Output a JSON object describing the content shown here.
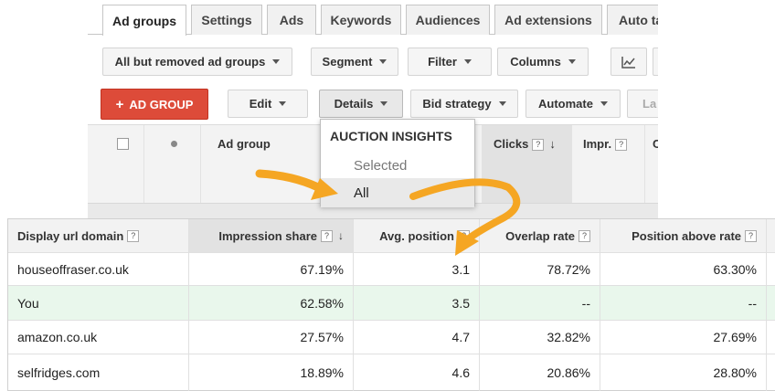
{
  "tabs": [
    {
      "label": "Ad groups",
      "active": true
    },
    {
      "label": "Settings"
    },
    {
      "label": "Ads"
    },
    {
      "label": "Keywords"
    },
    {
      "label": "Audiences"
    },
    {
      "label": "Ad extensions"
    },
    {
      "label": "Auto ta"
    }
  ],
  "toolbar1": {
    "view_filter": "All but removed ad groups",
    "segment": "Segment",
    "filter": "Filter",
    "columns": "Columns",
    "chart_icon": "line-chart-icon"
  },
  "toolbar2": {
    "add_plus": "+",
    "add_label": "AD GROUP",
    "edit": "Edit",
    "details": "Details",
    "bid_strategy": "Bid strategy",
    "automate": "Automate",
    "labels_partial": "La"
  },
  "grid_header": {
    "ad_group": "Ad group",
    "clicks": "Clicks",
    "impr": "Impr.",
    "c_partial": "C",
    "help": "?",
    "sort_down": "↓"
  },
  "dropdown": {
    "heading": "AUCTION INSIGHTS",
    "selected_label": "Selected",
    "all_label": "All"
  },
  "auction_table": {
    "help": "?",
    "sort_down": "↓",
    "headers": [
      "Display url domain",
      "Impression share",
      "Avg. position",
      "Overlap rate",
      "Position above rate"
    ],
    "rows": [
      [
        "houseoffraser.co.uk",
        "67.19%",
        "3.1",
        "78.72%",
        "63.30%"
      ],
      [
        "You",
        "62.58%",
        "3.5",
        "--",
        "--"
      ],
      [
        "amazon.co.uk",
        "27.57%",
        "4.7",
        "32.82%",
        "27.69%"
      ],
      [
        "selfridges.com",
        "18.89%",
        "4.6",
        "20.86%",
        "28.80%"
      ]
    ]
  },
  "colors": {
    "add_button": "#dd4b39",
    "annotation_arrow": "#f5a623",
    "you_row": "#e9f7ec"
  }
}
